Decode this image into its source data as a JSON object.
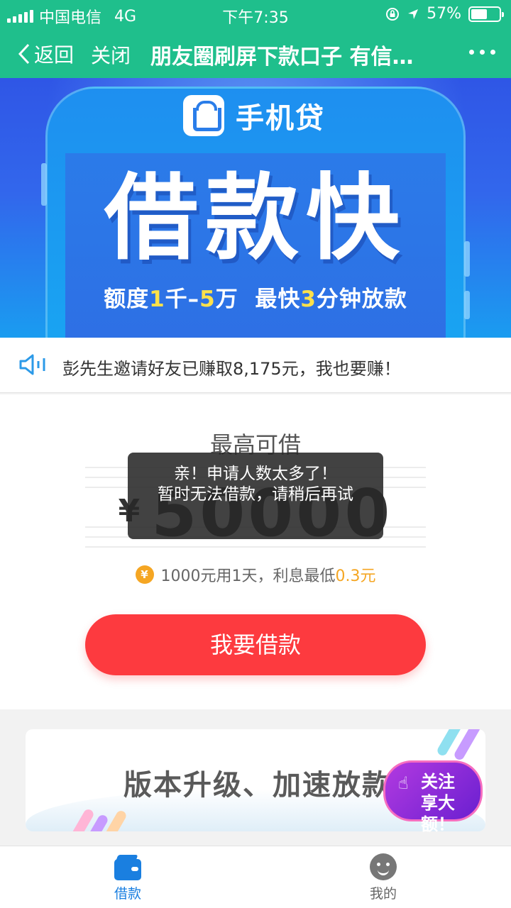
{
  "status_bar": {
    "carrier": "中国电信",
    "network": "4G",
    "time": "下午7:35",
    "battery": "57%",
    "battery_level": 0.57
  },
  "nav": {
    "back_label": "返回",
    "close_label": "关闭",
    "title": "朋友圈刷屏下款口子 有信用卡就能下款"
  },
  "banner": {
    "brand_name": "手机贷",
    "headline": "借款快",
    "sub_part1": "额度",
    "sub_hl1": "1",
    "sub_part2": "千–",
    "sub_hl2": "5",
    "sub_part3": "万  最快",
    "sub_hl3": "3",
    "sub_part4": "分钟放款"
  },
  "notice": {
    "text": "彭先生邀请好友已赚取8,175元，我也要赚！"
  },
  "loan": {
    "max_label": "最高可借",
    "currency_symbol": "¥",
    "amount": "50000",
    "interest_prefix": "1000元用1天，利息最低",
    "interest_value": "0.3元",
    "coin_symbol": "¥",
    "borrow_button": "我要借款"
  },
  "toast": {
    "line1": "亲！申请人数太多了！",
    "line2": "暂时无法借款，请稍后再试"
  },
  "promo": {
    "title": "版本升级、加速放款",
    "badge_line1": "关注",
    "badge_line2": "享大额！"
  },
  "tab_bar": {
    "items": [
      {
        "label": "借款",
        "icon": "wallet-icon",
        "active": true
      },
      {
        "label": "我的",
        "icon": "user-icon",
        "active": false
      }
    ]
  },
  "colors": {
    "nav_bg": "#1fbf8c",
    "primary_button": "#fd3a3f",
    "accent_orange": "#f5a623",
    "tab_active": "#1a7fe0"
  }
}
